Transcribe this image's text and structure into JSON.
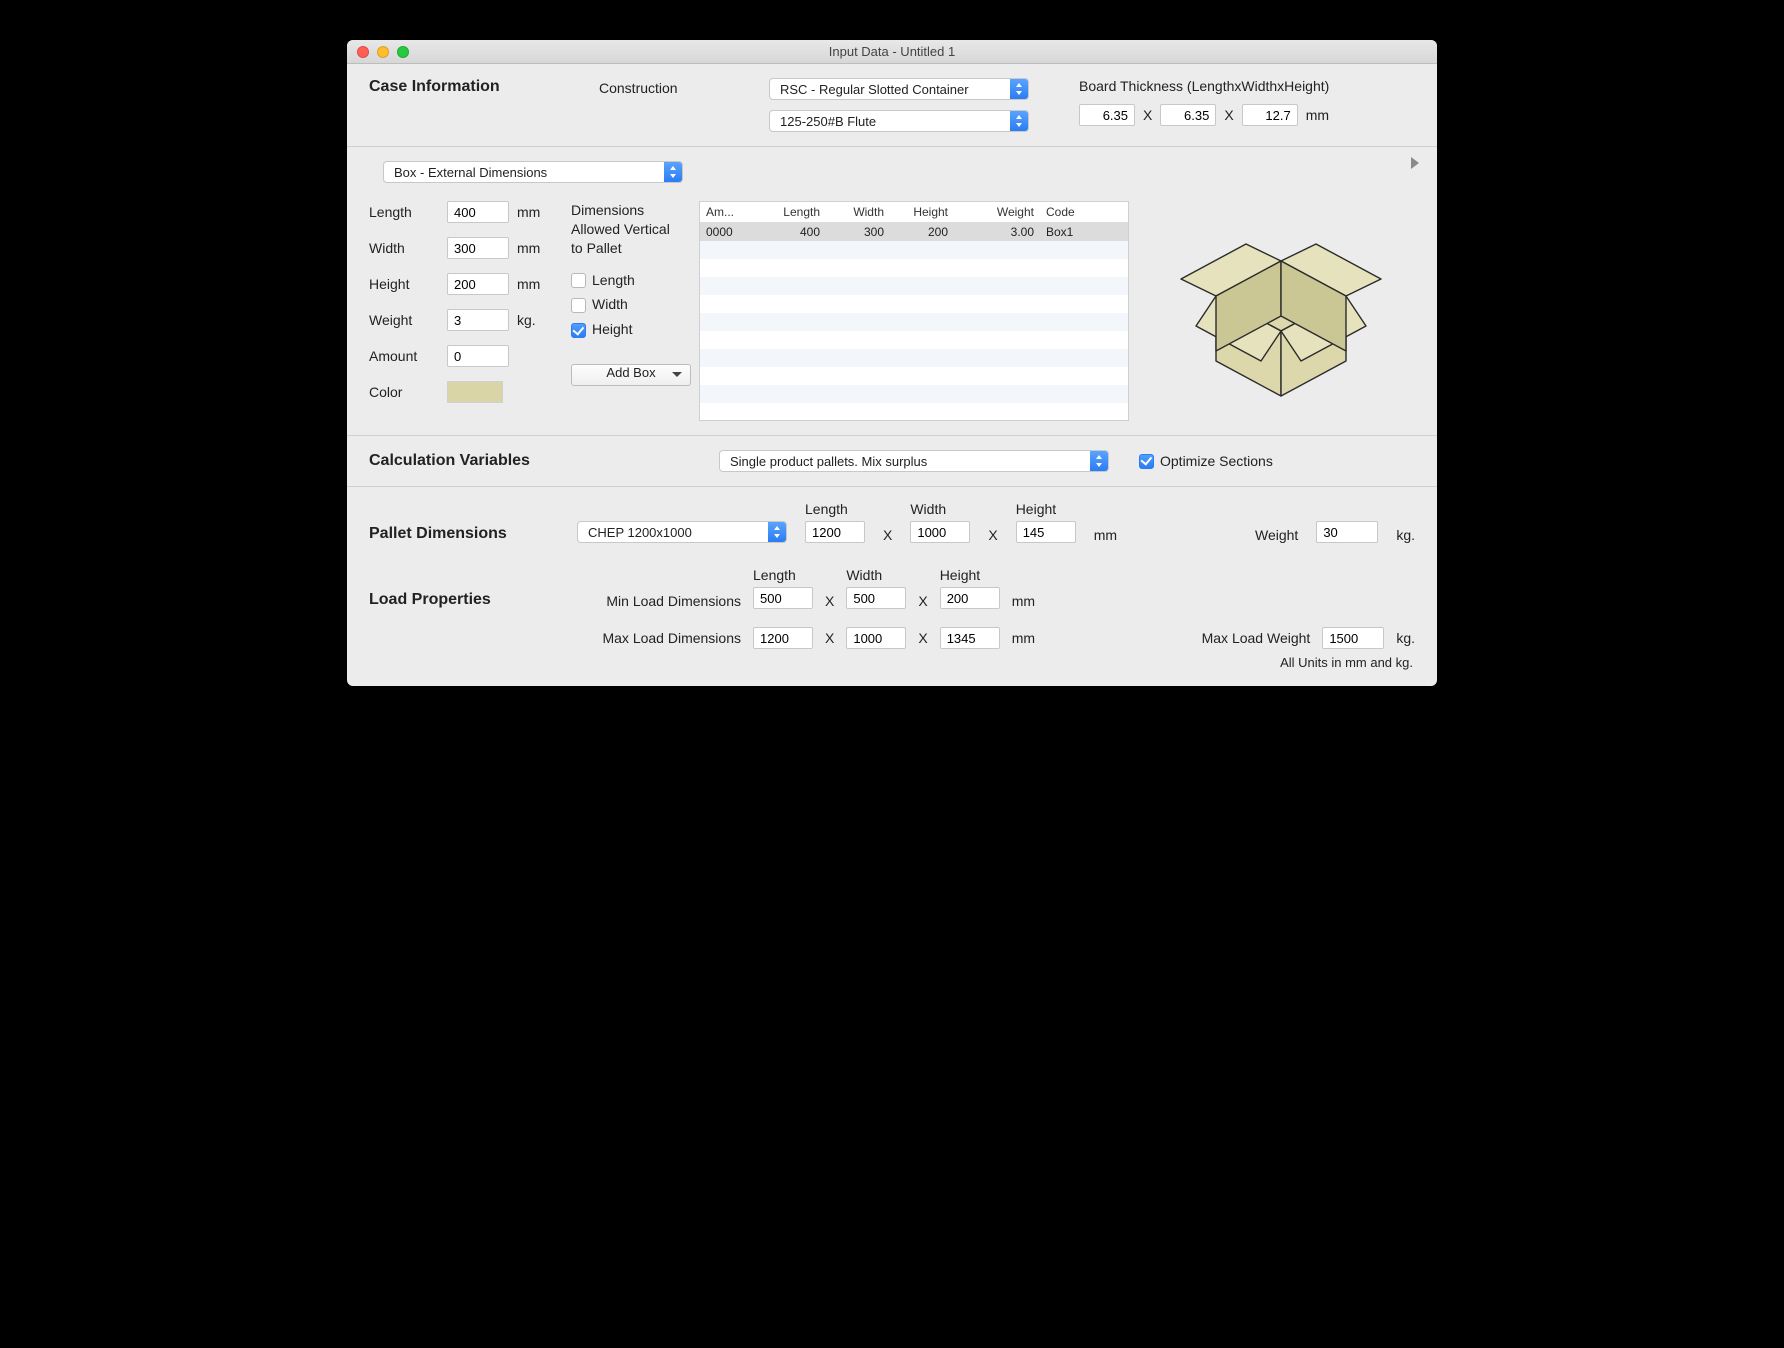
{
  "window": {
    "title": "Input Data - Untitled 1"
  },
  "case_info": {
    "heading": "Case Information",
    "construction_label": "Construction",
    "construction_value": "RSC - Regular Slotted Container",
    "flute_value": "125-250#B Flute",
    "board_label": "Board Thickness (LengthxWidthxHeight)",
    "board_l": "6.35",
    "board_w": "6.35",
    "board_h": "12.7",
    "board_unit": "mm",
    "x": "X"
  },
  "box": {
    "mode": "Box - External Dimensions",
    "labels": {
      "length": "Length",
      "width": "Width",
      "height": "Height",
      "weight": "Weight",
      "amount": "Amount",
      "color": "Color"
    },
    "units": {
      "mm": "mm",
      "kg": "kg."
    },
    "values": {
      "length": "400",
      "width": "300",
      "height": "200",
      "weight": "3",
      "amount": "0"
    },
    "dims_allowed_label": "Dimensions Allowed Vertical to Pallet",
    "allow": {
      "length": false,
      "width": false,
      "height": true
    },
    "allow_labels": {
      "length": "Length",
      "width": "Width",
      "height": "Height"
    },
    "add_box_label": "Add Box",
    "color_hex": "#d9d5a7",
    "table": {
      "headers": [
        "Am...",
        "Length",
        "Width",
        "Height",
        "Weight",
        "Code"
      ],
      "rows": [
        {
          "amount": "0000",
          "length": "400",
          "width": "300",
          "height": "200",
          "weight": "3.00",
          "code": "Box1"
        }
      ]
    }
  },
  "calc": {
    "heading": "Calculation Variables",
    "method": "Single product pallets. Mix surplus",
    "optimize_label": "Optimize Sections",
    "optimize_checked": true
  },
  "pallet": {
    "heading": "Pallet Dimensions",
    "type": "CHEP 1200x1000",
    "length_label": "Length",
    "width_label": "Width",
    "height_label": "Height",
    "length": "1200",
    "width": "1000",
    "height": "145",
    "unit": "mm",
    "weight_label": "Weight",
    "weight": "30",
    "weight_unit": "kg.",
    "x": "X"
  },
  "load": {
    "heading": "Load Properties",
    "min_label": "Min Load Dimensions",
    "max_label": "Max Load Dimensions",
    "length_label": "Length",
    "width_label": "Width",
    "height_label": "Height",
    "min": {
      "length": "500",
      "width": "500",
      "height": "200"
    },
    "max": {
      "length": "1200",
      "width": "1000",
      "height": "1345"
    },
    "unit": "mm",
    "x": "X",
    "max_weight_label": "Max Load Weight",
    "max_weight": "1500",
    "weight_unit": "kg."
  },
  "footer": "All Units in mm and kg."
}
